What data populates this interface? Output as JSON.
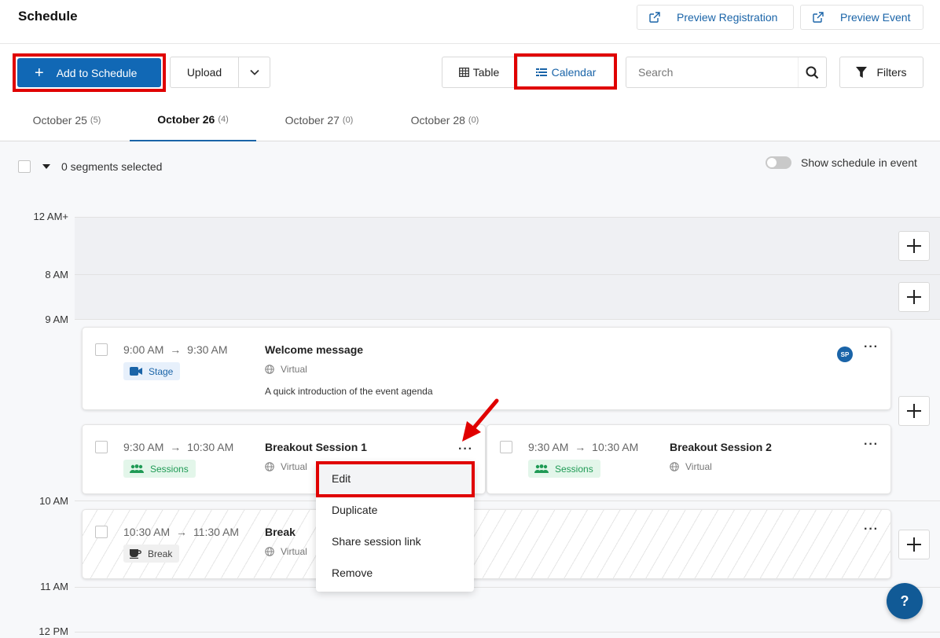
{
  "header": {
    "title": "Schedule",
    "preview_registration": "Preview Registration",
    "preview_event": "Preview Event"
  },
  "toolbar": {
    "add_label": "Add to Schedule",
    "upload_label": "Upload",
    "view_table": "Table",
    "view_calendar": "Calendar",
    "active_view": "Calendar",
    "search_placeholder": "Search",
    "filters_label": "Filters"
  },
  "tabs": [
    {
      "label": "October 25",
      "count": "(5)",
      "active": false
    },
    {
      "label": "October 26",
      "count": "(4)",
      "active": true
    },
    {
      "label": "October 27",
      "count": "(0)",
      "active": false
    },
    {
      "label": "October 28",
      "count": "(0)",
      "active": false
    }
  ],
  "selection": {
    "label": "0 segments selected",
    "show_schedule_label": "Show schedule in event",
    "show_schedule_on": false
  },
  "timeline": {
    "labels": [
      "12 AM+",
      "8 AM",
      "9 AM",
      "10 AM",
      "11 AM",
      "12 PM"
    ]
  },
  "segments": {
    "welcome": {
      "start": "9:00 AM",
      "end": "9:30 AM",
      "title": "Welcome message",
      "type": "Stage",
      "location": "Virtual",
      "description": "A quick introduction of the event agenda",
      "speaker_initials": "SP"
    },
    "breakout1": {
      "start": "9:30 AM",
      "end": "10:30 AM",
      "title": "Breakout Session 1",
      "type": "Sessions",
      "location": "Virtual"
    },
    "breakout2": {
      "start": "9:30 AM",
      "end": "10:30 AM",
      "title": "Breakout Session 2",
      "type": "Sessions",
      "location": "Virtual"
    },
    "break": {
      "start": "10:30 AM",
      "end": "11:30 AM",
      "title": "Break",
      "type": "Break",
      "location": "Virtual"
    }
  },
  "context_menu": {
    "items": [
      "Edit",
      "Duplicate",
      "Share session link",
      "Remove"
    ],
    "hovered": "Edit"
  },
  "help_label": "?",
  "colors": {
    "primary": "#1168b5",
    "link": "#1a64a8",
    "highlight": "#e00000",
    "sessions_green": "#1f9a55"
  }
}
